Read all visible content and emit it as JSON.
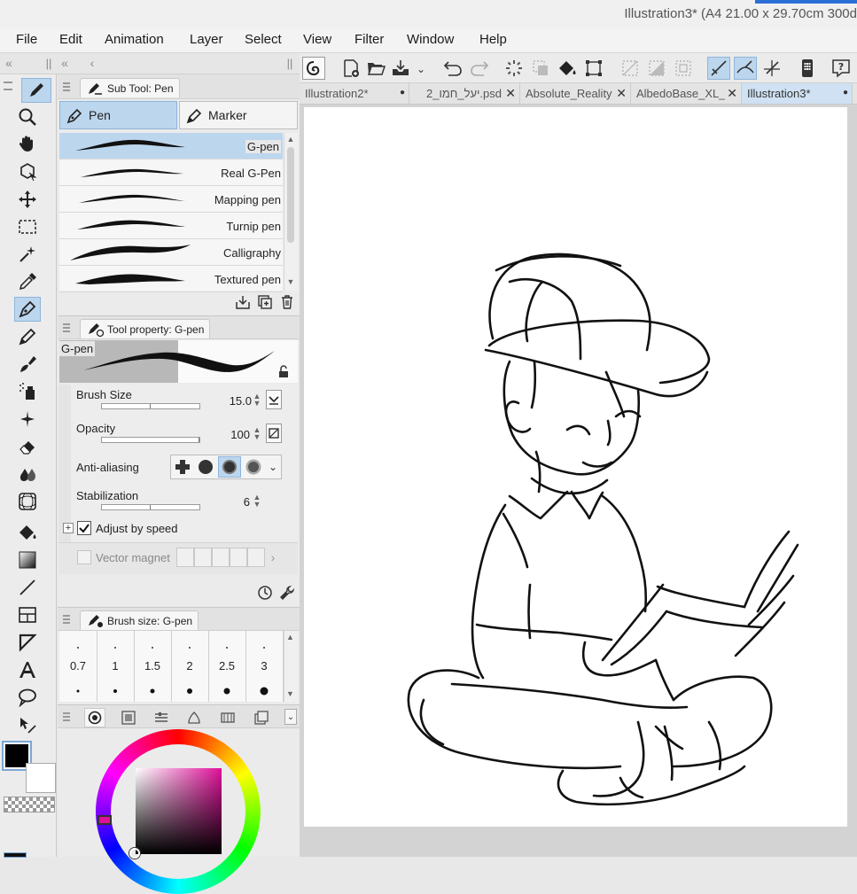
{
  "window": {
    "title": "Illustration3* (A4 21.00 x 29.70cm 300d"
  },
  "menu": [
    "File",
    "Edit",
    "Animation",
    "Layer",
    "Select",
    "View",
    "Filter",
    "Window",
    "Help"
  ],
  "subtool": {
    "panel_title": "Sub Tool: Pen",
    "tabs": [
      "Pen",
      "Marker"
    ],
    "brushes": [
      "G-pen",
      "Real G-Pen",
      "Mapping pen",
      "Turnip pen",
      "Calligraphy",
      "Textured pen"
    ],
    "selected": "G-pen"
  },
  "tool_property": {
    "panel_title": "Tool property: G-pen",
    "preview_label": "G-pen",
    "brush_size": {
      "label": "Brush Size",
      "value": "15.0",
      "fraction": 0.5
    },
    "opacity": {
      "label": "Opacity",
      "value": "100",
      "fraction": 1.0
    },
    "anti_aliasing": {
      "label": "Anti-aliasing",
      "selected_index": 2
    },
    "stabilization": {
      "label": "Stabilization",
      "value": "6",
      "fraction": 0.5
    },
    "adjust_by_speed": {
      "label": "Adjust by speed",
      "checked": true
    },
    "vector_magnet": {
      "label": "Vector magnet"
    }
  },
  "brush_size_panel": {
    "panel_title": "Brush size: G-pen",
    "sizes": [
      "0.7",
      "1",
      "1.5",
      "2",
      "2.5",
      "3"
    ]
  },
  "colors": {
    "main": "#000000",
    "sub": "#ffffff",
    "selection_accent": "#bcd6ee"
  },
  "document_tabs": [
    {
      "label": "Illustration2*",
      "close": "●"
    },
    {
      "label": "יעל_חמו_2.psd",
      "close": "✕"
    },
    {
      "label": "Absolute_Reality",
      "close": "✕"
    },
    {
      "label": "AlbedoBase_XL_",
      "close": "✕"
    },
    {
      "label": "Illustration3*",
      "close": "●",
      "active": true
    }
  ]
}
